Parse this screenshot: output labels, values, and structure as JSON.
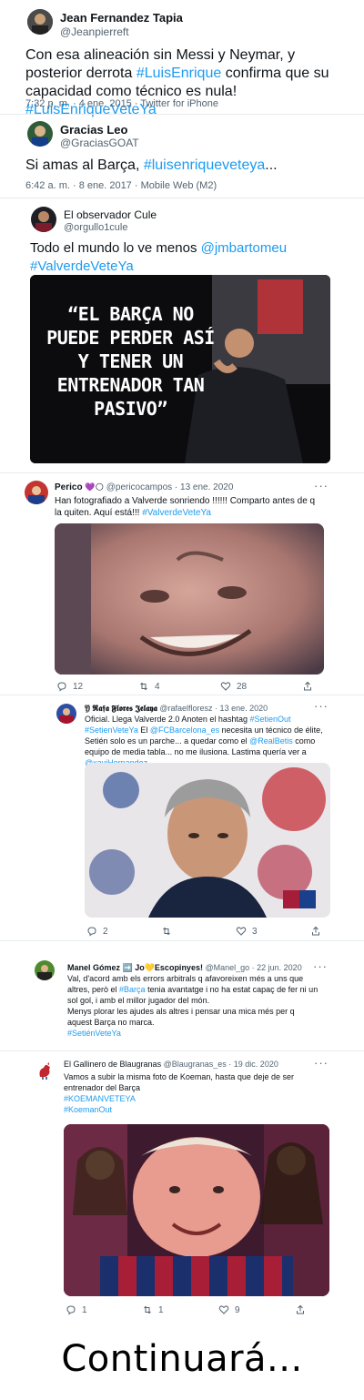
{
  "tweets": [
    {
      "name": "Jean Fernandez Tapia",
      "handle": "@Jeanpierreft",
      "text_before": "Con esa alineación sin Messi y Neymar, y posterior derrota ",
      "hashtag1": "#LuisEnrique",
      "text_middle": " confirma que su capacidad como técnico es nula! ",
      "hashtag2": "#LuisEnriqueVeteYa",
      "meta": "7:32 p. m. · 4 ene. 2015 · Twitter for iPhone"
    },
    {
      "name": "Gracias Leo",
      "handle": "@GraciasGOAT",
      "text_before": "Si amas al Barça, ",
      "hashtag1": "#luisenriqueveteya",
      "text_after": "...",
      "meta": "6:42 a. m. · 8 ene. 2017 · Mobile Web (M2)"
    },
    {
      "name": "El observador Cule",
      "handle": "@orgullo1cule",
      "text_before": "Todo el mundo lo ve menos ",
      "mention": "@jmbartomeu",
      "hashtag1": "#ValverdeVeteYa",
      "image_quote": "“EL BARÇA NO PUEDE PERDER ASÍ Y TENER UN ENTRENADOR TAN PASIVO”"
    },
    {
      "name": "Perico",
      "name_emoji": "💜🌕",
      "handle": "@pericocampos",
      "date": "· 13 ene. 2020",
      "text": "Han fotografiado a Valverde sonriendo !!!!!! Comparto antes de q la quiten. Aquí está!!! ",
      "hashtag1": "#ValverdeVeteYa",
      "replies": "12",
      "retweets": "4",
      "likes": "28"
    },
    {
      "name": "𝔜 𝕽𝖆𝖋𝖆 𝕱𝖑𝖔𝖗𝖊𝖘 𝕵𝖊𝖑𝖆𝖞𝖆",
      "handle": "@rafaelfloresz",
      "date": "· 13 ene. 2020",
      "line1_a": "Oficial. Llega Valverde 2.0 Anoten el hashtag ",
      "hashtag1": "#SetienOut",
      "hashtag2": "#SetienVeteYa",
      "line2_a": "El ",
      "mention1": "@FCBarcelona_es",
      "line2_b": " necesita un técnico de élite,  Setién solo es un parche... a quedar como el ",
      "mention2": "@RealBetis",
      "line2_c": " como equipo de media tabla... no me ilusiona. Lastima quería ver a ",
      "mention3": "@xaviHernandez",
      "replies": "2",
      "retweets": "",
      "likes": "3"
    },
    {
      "name": "Manel Gómez ➡️ Jo💛Escopinyes!",
      "handle": "@Manel_go",
      "date": "· 22 jun. 2020",
      "text_a": "Val, d'acord amb els errors arbitrals q afavoreixen més a uns que altres, però el ",
      "hashtag1": "#Barça",
      "text_b": " tenia avantatge i no ha estat capaç de fer ni un sol gol, i amb el millor jugador del món.",
      "text_c": "Menys plorar les ajudes als altres i pensar una mica més per q aquest Barça no marca.",
      "hashtag2": "#SetiénVeteYa"
    },
    {
      "name": "El Gallinero de Blaugranas",
      "handle": "@Blaugranas_es",
      "date": "· 19 dic. 2020",
      "text": "Vamos a subir la misma foto de Koeman, hasta que deje de ser entrenador del Barça",
      "hashtag1": "#KOEMANVETEYA",
      "hashtag2": "#KoemanOut",
      "replies": "1",
      "retweets": "1",
      "likes": "9"
    }
  ],
  "footer_text": "Continuará...",
  "colors": {
    "link": "#1d9bf0",
    "muted": "#536471"
  }
}
